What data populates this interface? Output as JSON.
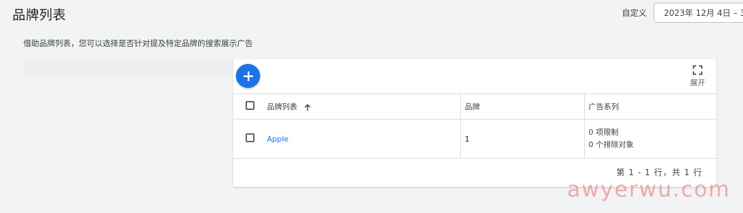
{
  "header": {
    "title": "品牌列表",
    "date_label": "自定义",
    "date_value": "2023年 12月 4日 – 3"
  },
  "description": "借助品牌列表，您可以选择是否针对提及特定品牌的搜索展示广告",
  "toolbar": {
    "add_icon": "plus-icon",
    "expand_label": "展开",
    "expand_icon": "fullscreen-icon"
  },
  "table": {
    "columns": [
      "品牌列表",
      "品牌",
      "广告系列"
    ],
    "sort_icon": "arrow-up-icon",
    "rows": [
      {
        "name": "Apple",
        "brands": "1",
        "campaign_line1": "0 项限制",
        "campaign_line2": "0 个排除对象"
      }
    ]
  },
  "pagination": "第 1 - 1 行，共 1 行",
  "watermark": "awyerwu.com",
  "colors": {
    "accent": "#1a73e8",
    "background": "#f1f3f4",
    "watermark": "#ef6c6c"
  }
}
